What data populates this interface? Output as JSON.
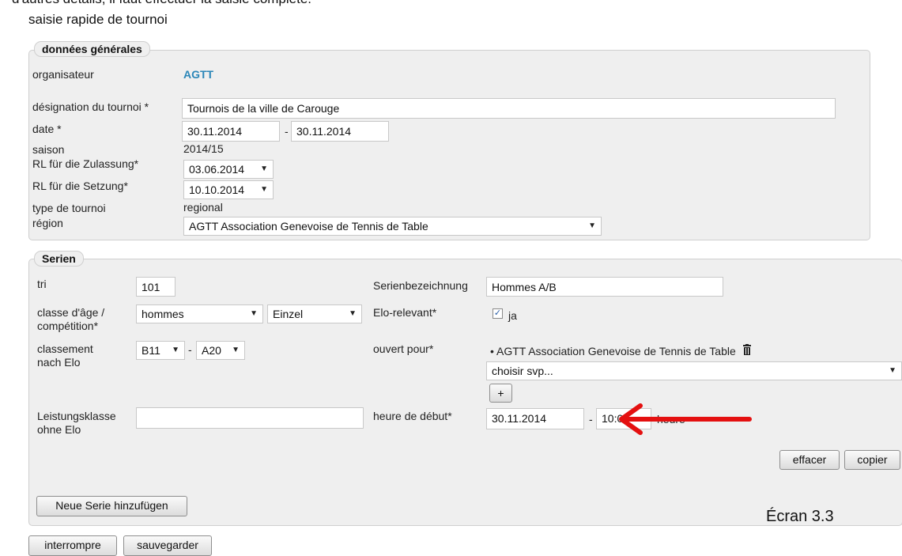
{
  "context_text": "d'autres détails, il faut effectuer la saisie complète.",
  "page_title": "saisie rapide de tournoi",
  "general": {
    "legend": "données générales",
    "organizer_label": "organisateur",
    "organizer_value": "AGTT",
    "designation_label": "désignation du tournoi *",
    "designation_value": "Tournois de la ville de Carouge",
    "date_label": "date *",
    "date_from": "30.11.2014",
    "date_sep": "-",
    "date_to": "30.11.2014",
    "season_label": "saison",
    "season_value": "2014/15",
    "rl_admission_label": "RL für die Zulassung*",
    "rl_admission_value": "03.06.2014",
    "rl_seeding_label": "RL für die Setzung*",
    "rl_seeding_value": "10.10.2014",
    "type_label": "type de tournoi",
    "type_value": "regional",
    "region_label": "région",
    "region_value": "AGTT Association Genevoise de Tennis de Table"
  },
  "series": {
    "legend": "Serien",
    "sort_label": "tri",
    "sort_value": "101",
    "series_name_label": "Serienbezeichnung",
    "series_name_value": "Hommes A/B",
    "age_class_label_line1": "classe d'âge /",
    "age_class_label_line2": "compétition*",
    "age_class_value": "hommes",
    "competition_value": "Einzel",
    "elo_relevant_label": "Elo-relevant*",
    "elo_relevant_checked": true,
    "elo_relevant_text": "ja",
    "ranking_label_line1": "classement",
    "ranking_label_line2": "nach Elo",
    "ranking_from": "B11",
    "ranking_sep": "-",
    "ranking_to": "A20",
    "open_for_label": "ouvert pour*",
    "open_for_item": "• AGTT Association Genevoise de Tennis de Table",
    "open_for_select": "choisir svp...",
    "add_label": "+",
    "performance_label_line1": "Leistungsklasse",
    "performance_label_line2": "ohne Elo",
    "performance_value": "",
    "start_label": "heure de début*",
    "start_date": "30.11.2014",
    "start_sep": "-",
    "start_time": "10:00",
    "start_unit": "heure",
    "delete_label": "effacer",
    "copy_label": "copier",
    "new_series_label": "Neue Serie hinzufügen"
  },
  "footer": {
    "interrupt_label": "interrompre",
    "save_label": "sauvegarder"
  },
  "annotation": {
    "caption": "Écran 3.3",
    "arrow_color": "#e41010"
  },
  "icons": {
    "trash": "trash-icon",
    "dropdown": "chevron-down-icon"
  }
}
